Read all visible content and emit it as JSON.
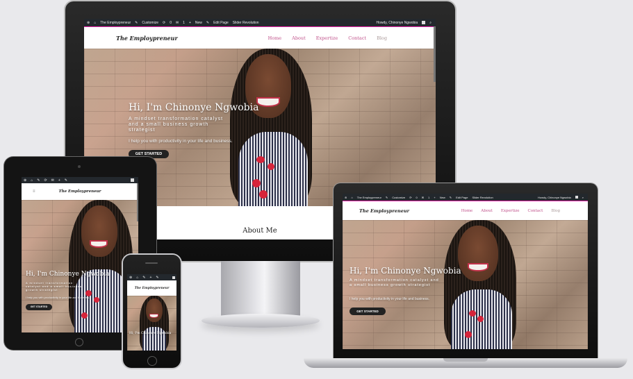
{
  "colors": {
    "admin_bar": "#23282d",
    "nav_link": "#c0508a",
    "cta_bg": "#222222",
    "bezel": "#141414",
    "background": "#e9e9ec"
  },
  "admin_bar": {
    "site_name": "The Employpreneur",
    "customize": "Customize",
    "updates": "0",
    "comments": "1",
    "new": "New",
    "edit_page": "Edit Page",
    "slider": "Slider Revolution",
    "howdy": "Howdy, Chinonye Ngwobia"
  },
  "site": {
    "logo": "The Employpreneur",
    "nav": [
      "Home",
      "About",
      "Expertize",
      "Contact",
      "Blog"
    ]
  },
  "hero": {
    "title": "Hi, I'm Chinonye Ngwobia",
    "subtitle": "A mindset transformation catalyst and a small business growth strategist",
    "text": "I help you with productivity in your life and business.",
    "cta": "GET STARTED"
  },
  "about": {
    "heading": "About Me"
  }
}
